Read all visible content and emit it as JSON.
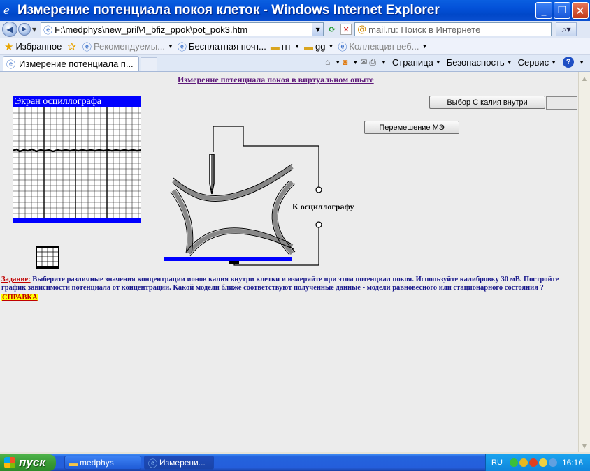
{
  "window": {
    "title": "Измерение потенциала покоя клеток - Windows Internet Explorer",
    "minimize": "_",
    "maximize": "❐",
    "close": "✕"
  },
  "address": {
    "url": "F:\\medphys\\new_pril\\4_bfiz_ppok\\pot_pok3.htm",
    "search_placeholder": "mail.ru: Поиск в Интернете",
    "back": "◀",
    "forward": "▶"
  },
  "favorites": {
    "label": "Избранное",
    "items": [
      {
        "label": "Рекомендуемы...",
        "dim": true,
        "type": "ie"
      },
      {
        "label": "Бесплатная почт...",
        "dim": false,
        "type": "ie"
      },
      {
        "label": "ггг",
        "dim": false,
        "type": "folder"
      },
      {
        "label": "gg",
        "dim": false,
        "type": "folder"
      },
      {
        "label": "Коллекция веб...",
        "dim": true,
        "type": "ie"
      }
    ]
  },
  "tabs": {
    "active": "Измерение потенциала п...",
    "commands": [
      "Страница",
      "Безопасность",
      "Сервис"
    ],
    "help": "?"
  },
  "page": {
    "title": "Измерение потенциала покоя в виртуальном опыте ",
    "osc_title": "Экран осциллографа",
    "to_oscilloscope": "К осциллографу",
    "btn_calc": "Выбор С калия внутри",
    "calc_value": "",
    "btn_move": "Перемешение МЭ",
    "task_label": "Задание:",
    "task_text": " Выберите различные значения концентрации ионов калия внутри клетки и измеряйте при этом   потенциал покоя. Используйте калибровку 30 мВ.  Постройте график  зависимости потенциала от концентрации. Какой модели ближе соответствуют полученные данные - модели равновесного или стационарного состояния ?",
    "help_link": "СПРАВКА"
  },
  "taskbar": {
    "start": "пуск",
    "items": [
      "medphys",
      "Измерени..."
    ],
    "lang": "RU",
    "clock": "16:16"
  },
  "colors": {
    "accent_blue": "#0000ff",
    "task_text": "#1a1a8c",
    "task_label": "#c00000",
    "title_purple": "#5e1a7a"
  }
}
